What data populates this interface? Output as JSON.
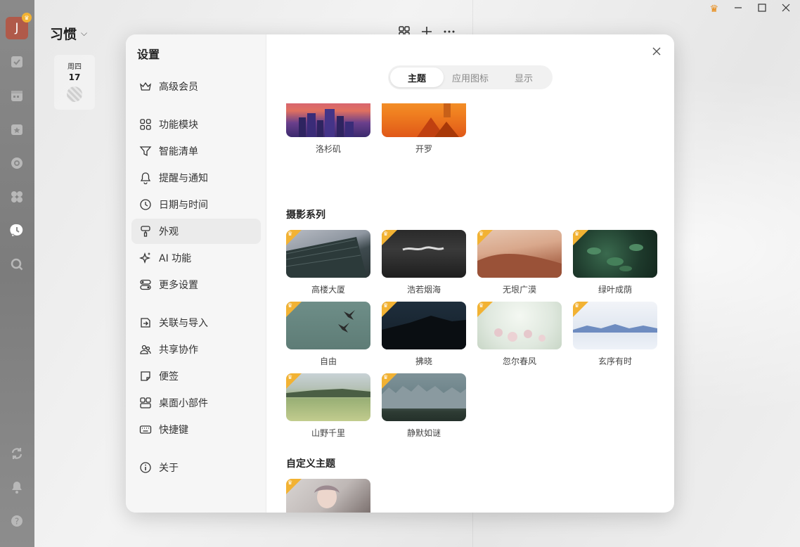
{
  "app": {
    "avatar_letter": "J",
    "title": "习惯",
    "date_card": {
      "weekday": "周四",
      "day": "17"
    }
  },
  "settings": {
    "title": "设置",
    "nav": [
      {
        "label": "高级会员",
        "icon": "crown-icon"
      },
      {
        "label": "功能模块",
        "icon": "grid-icon"
      },
      {
        "label": "智能清单",
        "icon": "filter-icon"
      },
      {
        "label": "提醒与通知",
        "icon": "bell-icon"
      },
      {
        "label": "日期与时间",
        "icon": "clock-icon"
      },
      {
        "label": "外观",
        "icon": "brush-icon",
        "active": true
      },
      {
        "label": "AI 功能",
        "icon": "sparkle-icon"
      },
      {
        "label": "更多设置",
        "icon": "toggle-icon"
      },
      {
        "label": "关联与导入",
        "icon": "import-icon"
      },
      {
        "label": "共享协作",
        "icon": "people-icon"
      },
      {
        "label": "便签",
        "icon": "note-icon"
      },
      {
        "label": "桌面小部件",
        "icon": "widget-icon"
      },
      {
        "label": "快捷键",
        "icon": "keyboard-icon"
      },
      {
        "label": "关于",
        "icon": "info-icon"
      }
    ],
    "tabs": [
      "主题",
      "应用图标",
      "显示"
    ],
    "active_tab": "主题",
    "city_themes": [
      {
        "name": "洛杉矶"
      },
      {
        "name": "开罗"
      }
    ],
    "photo_section_title": "摄影系列",
    "photo_themes": [
      {
        "name": "高楼大厦"
      },
      {
        "name": "浩若烟海"
      },
      {
        "name": "无垠广漠"
      },
      {
        "name": "绿叶成荫"
      },
      {
        "name": "自由"
      },
      {
        "name": "拂晓"
      },
      {
        "name": "忽尔春风"
      },
      {
        "name": "玄序有时"
      },
      {
        "name": "山野千里"
      },
      {
        "name": "静默如谜"
      }
    ],
    "custom_section_title": "自定义主题"
  },
  "colors": {
    "vip_badge": "#f2b233",
    "title_bar_crown": "#e8860c"
  }
}
